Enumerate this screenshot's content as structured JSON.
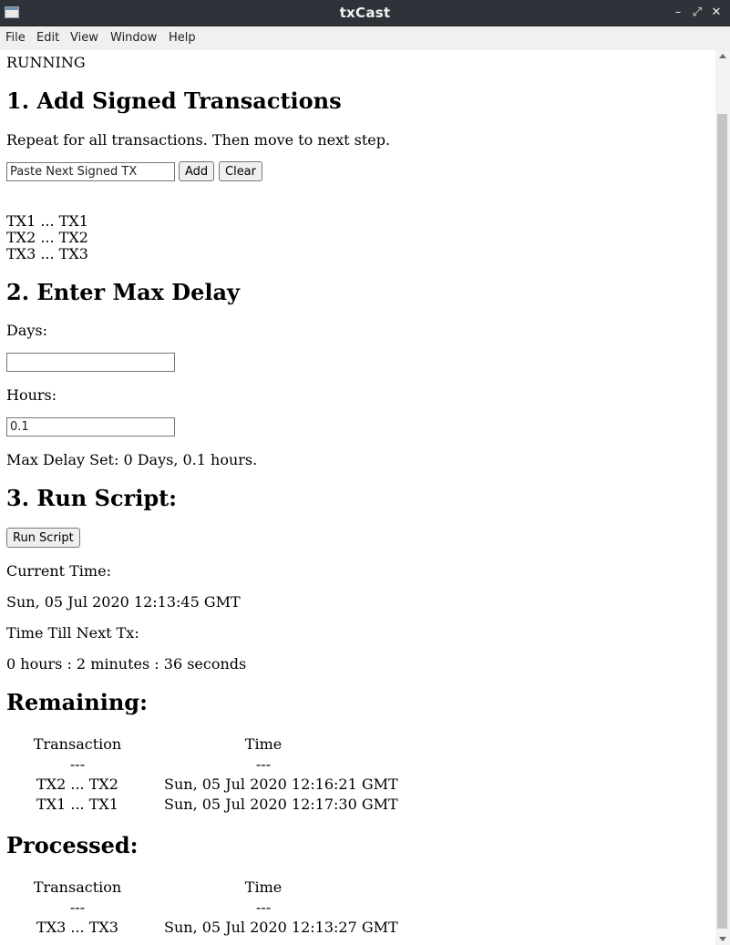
{
  "window": {
    "title": "txCast",
    "icon": "window-app-icon"
  },
  "window_controls": {
    "minimize": "–",
    "maximize": "⤢",
    "close": "✕"
  },
  "menu": [
    "File",
    "Edit",
    "View",
    "Window",
    "Help"
  ],
  "status": "RUNNING",
  "step1": {
    "heading": "1. Add Signed Transactions",
    "instruction": "Repeat for all transactions. Then move to next step.",
    "input_value": "Paste Next Signed TX",
    "add_label": "Add",
    "clear_label": "Clear",
    "tx_list": [
      "TX1 ... TX1",
      "TX2 ... TX2",
      "TX3 ... TX3"
    ]
  },
  "step2": {
    "heading": "2. Enter Max Delay",
    "days_label": "Days:",
    "days_value": "",
    "hours_label": "Hours:",
    "hours_value": "0.1",
    "max_delay_text": "Max Delay Set: 0 Days, 0.1 hours."
  },
  "step3": {
    "heading": "3. Run Script:",
    "run_label": "Run Script",
    "current_time_label": "Current Time:",
    "current_time": "Sun, 05 Jul 2020 12:13:45 GMT",
    "time_till_label": "Time Till Next Tx:",
    "time_till": "0 hours : 2 minutes : 36 seconds"
  },
  "remaining": {
    "heading": "Remaining:",
    "col_transaction": "Transaction",
    "col_time": "Time",
    "separator": "---",
    "rows": [
      {
        "tx": "TX2 ... TX2",
        "time": "Sun, 05 Jul 2020 12:16:21 GMT"
      },
      {
        "tx": "TX1 ... TX1",
        "time": "Sun, 05 Jul 2020 12:17:30 GMT"
      }
    ]
  },
  "processed": {
    "heading": "Processed:",
    "col_transaction": "Transaction",
    "col_time": "Time",
    "separator": "---",
    "rows": [
      {
        "tx": "TX3 ... TX3",
        "time": "Sun, 05 Jul 2020 12:13:27 GMT"
      }
    ]
  }
}
